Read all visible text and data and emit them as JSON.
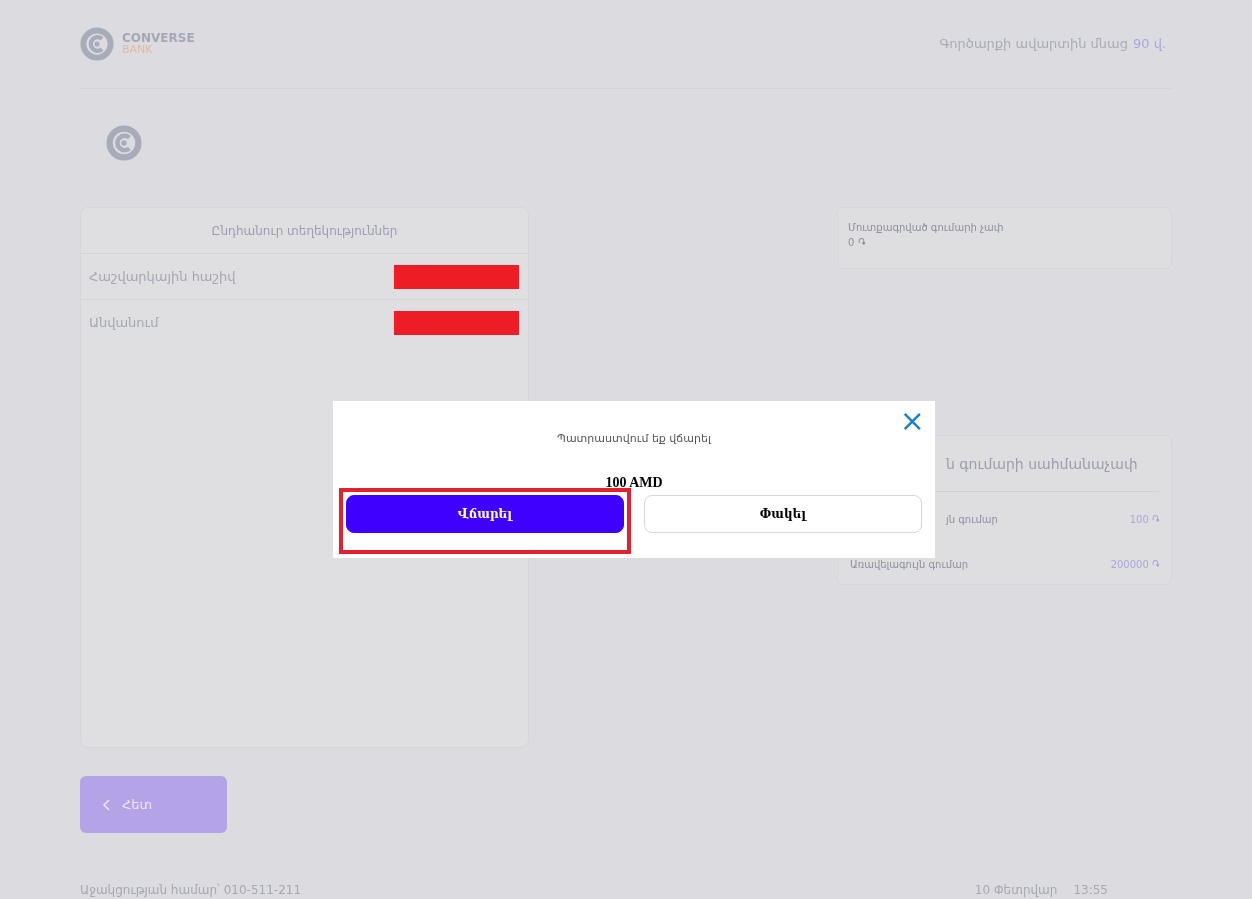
{
  "header": {
    "logo": {
      "name": "CONVERSE",
      "sub": "BANK"
    },
    "timer": {
      "label": "Գործարքի ավարտին մնաց",
      "value": "90 վ."
    }
  },
  "info_card": {
    "title": "Ընդհանուր տեղեկություններ",
    "rows": [
      {
        "label": "Հաշվարկային հաշիվ",
        "redacted": true
      },
      {
        "label": "Անվանում",
        "redacted": true
      }
    ]
  },
  "amount_card": {
    "label": "Մուտքագրված գումարի չափ",
    "value": "0 ֏"
  },
  "limits_card": {
    "title": "ն գումարի սահմանաչափ",
    "rows": [
      {
        "label": "յն գումար",
        "value": "100 ֏",
        "covered": true
      },
      {
        "label": "Առավելագույն գումար",
        "value": "200000 ֏",
        "covered": false
      }
    ]
  },
  "back_button": {
    "label": "Հետ"
  },
  "footer": {
    "support": "Աջակցության համար՝ 010-511-211",
    "date": "10 Փետրվար",
    "time": "13:55"
  },
  "modal": {
    "message": "Պատրաստվում եք վճարել",
    "amount": "100 AMD",
    "close": "×",
    "buttons": [
      {
        "label": "Վճարել",
        "kind": "primary",
        "highlighted": true
      },
      {
        "label": "Փակել",
        "kind": "secondary",
        "highlighted": false
      }
    ]
  }
}
